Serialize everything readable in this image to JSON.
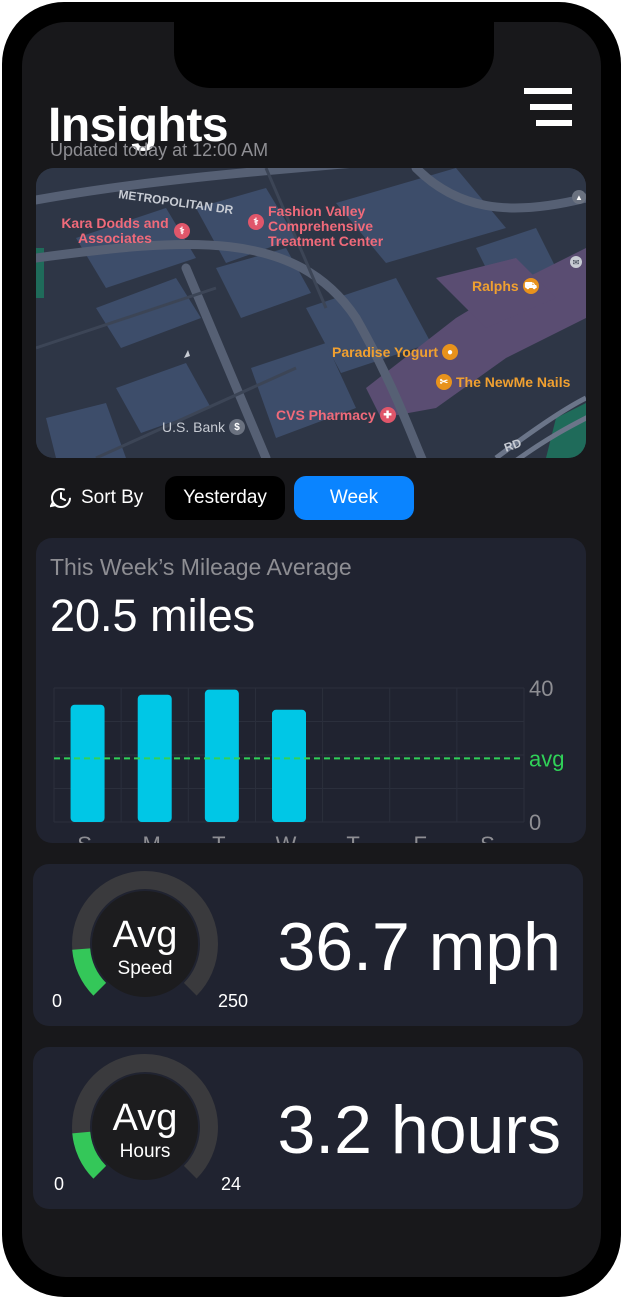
{
  "header": {
    "title": "Insights",
    "updated": "Updated today at 12:00 AM"
  },
  "map": {
    "street": "METROPOLITAN DR",
    "street2": "RD",
    "pois": [
      {
        "label": "Kara Dodds and Associates",
        "icon": "medical-icon",
        "color": "#f06a7a"
      },
      {
        "label": "Fashion Valley Comprehensive Treatment Center",
        "icon": "medical-icon",
        "color": "#f06a7a"
      },
      {
        "label": "Ralphs",
        "icon": "cart-icon",
        "color": "#f0a030"
      },
      {
        "label": "Paradise Yogurt",
        "icon": "ice-cream-icon",
        "color": "#f0a030"
      },
      {
        "label": "The NewMe Nails",
        "icon": "salon-icon",
        "color": "#f0a030"
      },
      {
        "label": "CVS Pharmacy",
        "icon": "pharmacy-icon",
        "color": "#f06a7a"
      },
      {
        "label": "U.S. Bank",
        "icon": "bank-icon",
        "color": "#c8ccd4"
      }
    ]
  },
  "sort": {
    "label": "Sort By",
    "options": [
      "Yesterday",
      "Week"
    ],
    "selected": "Week"
  },
  "mileage": {
    "label": "This Week’s Mileage Average",
    "value": "20.5 miles"
  },
  "chart_data": {
    "type": "bar",
    "categories": [
      "S",
      "M",
      "T",
      "W",
      "T",
      "F",
      "S"
    ],
    "values": [
      35,
      38,
      39.5,
      33.5,
      null,
      null,
      null
    ],
    "ylim": [
      0,
      40
    ],
    "y_ticks": [
      "40",
      "0"
    ],
    "average_label": "avg",
    "average_value": 19,
    "bar_color": "#00c7e6",
    "avg_color": "#30d158"
  },
  "speed": {
    "title": "Avg",
    "subtitle": "Speed",
    "min": "0",
    "max": "250",
    "fraction": 0.15,
    "value": "36.7 mph"
  },
  "hours": {
    "title": "Avg",
    "subtitle": "Hours",
    "min": "0",
    "max": "24",
    "fraction": 0.13,
    "value": "3.2 hours"
  },
  "colors": {
    "accent": "#0a84ff",
    "gauge_fill": "#34c759",
    "gauge_track": "#3a3a3d"
  }
}
